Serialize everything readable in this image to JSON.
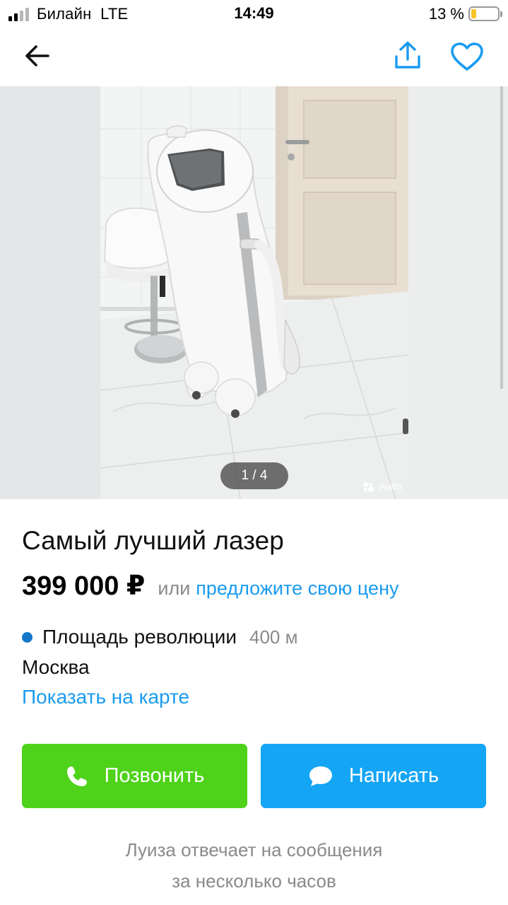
{
  "status_bar": {
    "carrier": "Билайн",
    "network": "LTE",
    "time": "14:49",
    "battery_percent": "13 %",
    "battery_level": 0.13,
    "signal_bars": 2,
    "signal_bars_total": 4
  },
  "nav": {
    "back_icon": "arrow-left-icon",
    "share_icon": "share-icon",
    "favorite_icon": "heart-icon",
    "accent_color": "#1a9bf0"
  },
  "gallery": {
    "counter": "1 / 4",
    "current": 1,
    "total": 4,
    "watermark": "Avito"
  },
  "listing": {
    "title": "Самый лучший лазер",
    "price": "399 000 ₽",
    "price_or": "или",
    "offer_link": "предложите свою цену",
    "metro_station": "Площадь революции",
    "metro_distance": "400 м",
    "metro_color": "#1578c9",
    "city": "Москва",
    "map_link": "Показать на карте"
  },
  "actions": {
    "call_label": "Позвонить",
    "call_icon": "phone-icon",
    "call_color": "#4fd21a",
    "write_label": "Написать",
    "write_icon": "chat-bubble-icon",
    "write_color": "#14a5f5"
  },
  "seller": {
    "response_line1": "Луиза отвечает на сообщения",
    "response_line2": "за несколько часов"
  }
}
